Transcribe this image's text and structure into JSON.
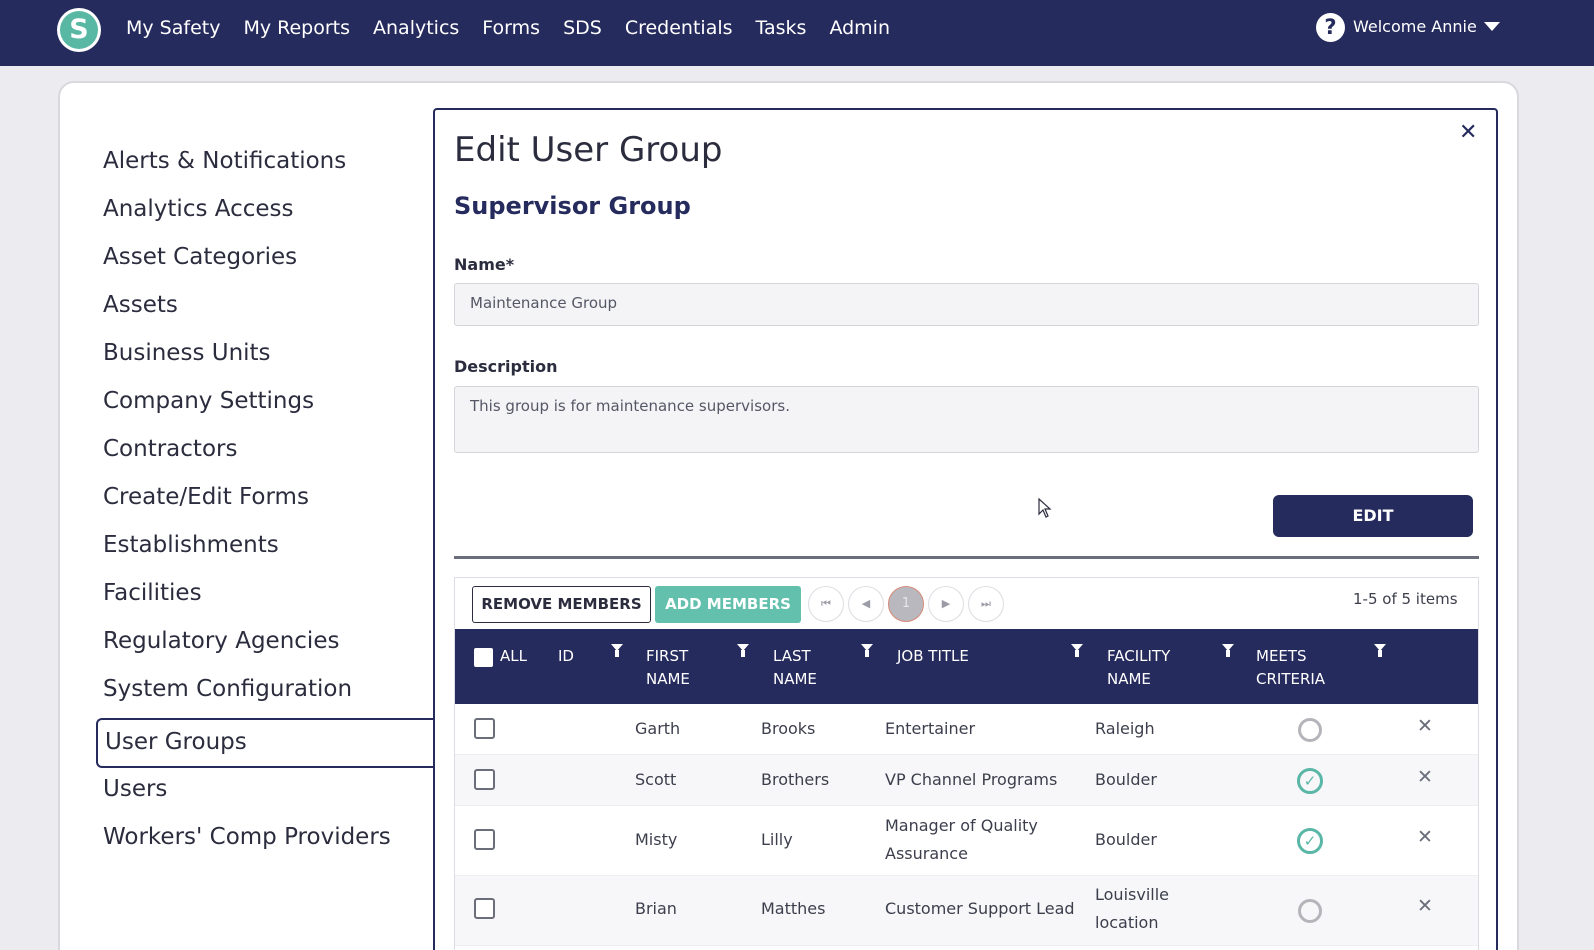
{
  "nav": {
    "logo_letter": "S",
    "items": [
      "My Safety",
      "My Reports",
      "Analytics",
      "Forms",
      "SDS",
      "Credentials",
      "Tasks",
      "Admin"
    ],
    "help_icon": "question-circle-icon",
    "welcome": "Welcome Annie"
  },
  "sidebar": {
    "items": [
      "Alerts & Notifications",
      "Analytics Access",
      "Asset Categories",
      "Assets",
      "Business Units",
      "Company Settings",
      "Contractors",
      "Create/Edit Forms",
      "Establishments",
      "Facilities",
      "Regulatory Agencies",
      "System Configuration",
      "User Groups",
      "Users",
      "Workers' Comp Providers"
    ],
    "active": "User Groups"
  },
  "modal": {
    "title": "Edit User Group",
    "subtitle": "Supervisor Group",
    "name_label": "Name*",
    "name_value": "Maintenance Group",
    "description_label": "Description",
    "description_value": "This group is for maintenance supervisors.",
    "edit_button": "EDIT"
  },
  "grid": {
    "remove_button": "REMOVE MEMBERS",
    "add_button": "ADD MEMBERS",
    "current_page": "1",
    "items_summary": "1-5 of 5 items",
    "headers": {
      "all": "ALL",
      "id": "ID",
      "first_name_1": "FIRST",
      "first_name_2": "NAME",
      "last_name_1": "LAST",
      "last_name_2": "NAME",
      "job_title": "JOB TITLE",
      "facility_1": "FACILITY",
      "facility_2": "NAME",
      "meets_1": "MEETS",
      "meets_2": "CRITERIA"
    },
    "rows": [
      {
        "first": "Garth",
        "last": "Brooks",
        "job_1": "Entertainer",
        "job_2": "",
        "facility_1": "Raleigh",
        "facility_2": "",
        "meets_criteria": false
      },
      {
        "first": "Scott",
        "last": "Brothers",
        "job_1": "VP Channel Programs",
        "job_2": "",
        "facility_1": "Boulder",
        "facility_2": "",
        "meets_criteria": true
      },
      {
        "first": "Misty",
        "last": "Lilly",
        "job_1": "Manager of Quality",
        "job_2": "Assurance",
        "facility_1": "Boulder",
        "facility_2": "",
        "meets_criteria": true
      },
      {
        "first": "Brian",
        "last": "Matthes",
        "job_1": "Customer Support Lead",
        "job_2": "",
        "facility_1": "Louisville",
        "facility_2": "location",
        "meets_criteria": false
      }
    ]
  },
  "colors": {
    "navy": "#262b5e",
    "teal": "#62c0ac"
  }
}
